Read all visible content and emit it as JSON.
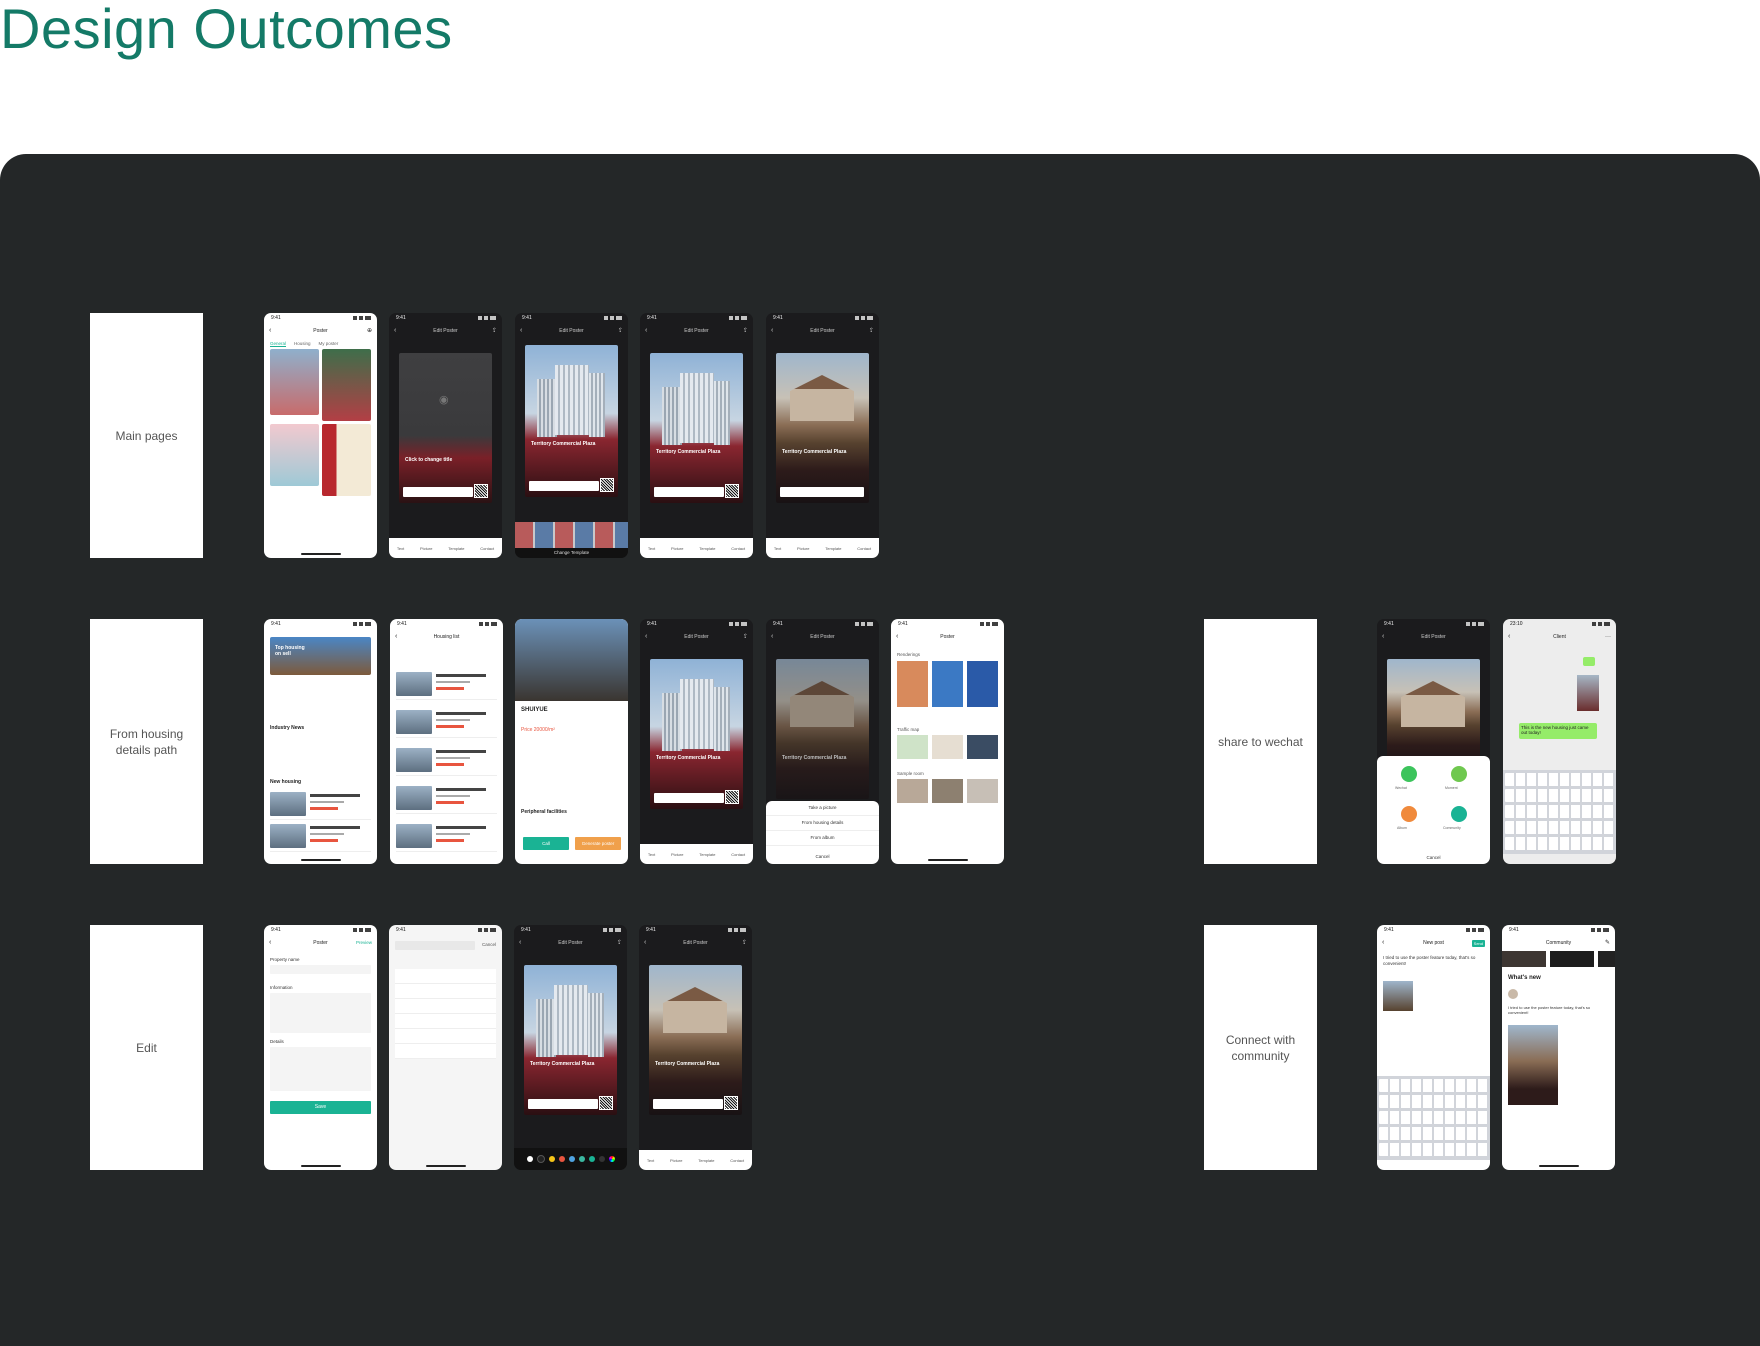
{
  "page": {
    "title": "Design Outcomes"
  },
  "labels": {
    "main_pages": "Main pages",
    "housing_path": "From housing details path",
    "share": "share to wechat",
    "edit": "Edit",
    "community": "Connect with community"
  },
  "phone": {
    "time": "9:41",
    "time_chat": "23:10",
    "poster": "Poster",
    "edit_poster": "Edit Poster",
    "housing_list": "Housing list",
    "new_post": "New post",
    "community": "Community",
    "client": "Client",
    "tab_general": "General",
    "tab_housing": "Housing",
    "tab_myposter": "My poster",
    "click_change": "Click to change title",
    "poster_title": "Territory Commercial Plaza",
    "upload": "Upload Photo",
    "change_template": "Change Template",
    "tool_text": "Text",
    "tool_picture": "Picture",
    "tool_template": "Template",
    "tool_contact": "Contact",
    "take_picture": "Take a picture",
    "from_housing": "From housing details",
    "from_album": "From album",
    "cancel": "Cancel",
    "renderings": "Renderings",
    "traffic_map": "Traffic map",
    "sample_room": "Sample room",
    "top_housing": "Top housing on sell",
    "industry_news": "Industry News",
    "new_housing": "New housing",
    "shuiyue": "SHUIYUE",
    "price": "Price 20000/m²",
    "peripheral": "Peripheral facilities",
    "call": "Call",
    "generate": "Generate poster",
    "property_name": "Property name",
    "information": "Information",
    "details": "Details",
    "save": "Save",
    "preview": "Preview",
    "whats_new": "What's new",
    "share_text": "This is the new housing just came out today!",
    "send": "Send",
    "post_text": "I tried to use the poster feature today, that's so convenient!",
    "wechat": "Wechat",
    "moment": "Moment",
    "album": "Album",
    "community_btn": "Community"
  }
}
